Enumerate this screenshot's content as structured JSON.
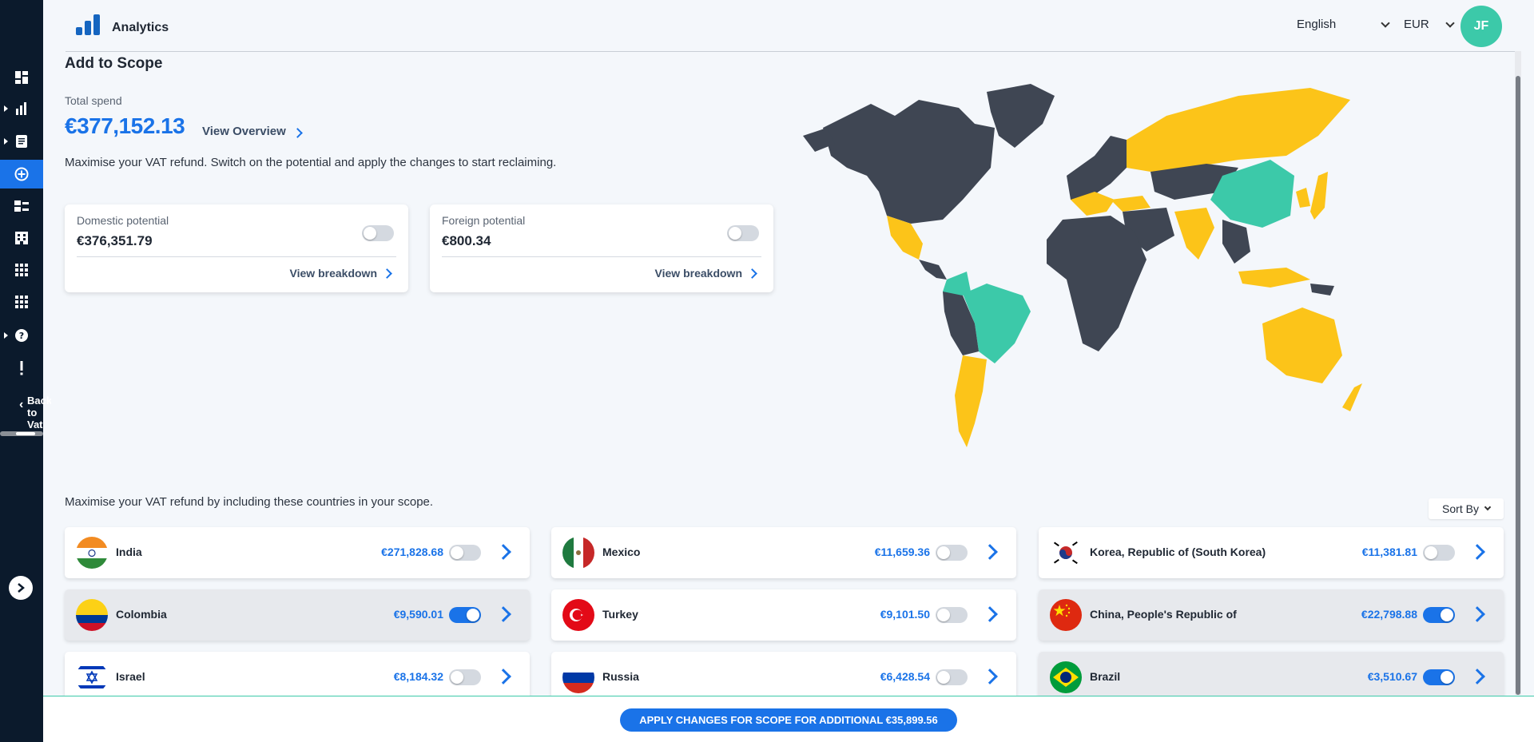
{
  "app": {
    "title": "Analytics"
  },
  "header": {
    "language": "English",
    "currency": "EUR",
    "avatar_initials": "JF"
  },
  "sidebar": {
    "back_label": "Back to Vat",
    "items": [
      {
        "icon": "dashboard-icon"
      },
      {
        "icon": "bar-chart-icon"
      },
      {
        "icon": "document-icon"
      },
      {
        "icon": "add-circle-icon",
        "active": true
      },
      {
        "icon": "list-icon"
      },
      {
        "icon": "building-icon"
      },
      {
        "icon": "grid-icon"
      },
      {
        "icon": "grid-alt-icon"
      },
      {
        "icon": "help-icon"
      },
      {
        "icon": "alert-icon"
      }
    ]
  },
  "page": {
    "title": "Add to Scope",
    "total_label": "Total spend",
    "total_value": "€377,152.13",
    "view_overview": "View Overview",
    "intro": "Maximise your VAT refund. Switch on the potential and apply the changes to start reclaiming.",
    "sub_intro": "Maximise your VAT refund by including these countries in your scope.",
    "sort_by": "Sort By"
  },
  "potentials": {
    "domestic": {
      "label": "Domestic potential",
      "value": "€376,351.79",
      "link": "View breakdown",
      "on": false
    },
    "foreign": {
      "label": "Foreign potential",
      "value": "€800.34",
      "link": "View breakdown",
      "on": false
    }
  },
  "countries": [
    {
      "name": "India",
      "amount": "€271,828.68",
      "on": false
    },
    {
      "name": "Mexico",
      "amount": "€11,659.36",
      "on": false
    },
    {
      "name": "Korea, Republic of (South Korea)",
      "amount": "€11,381.81",
      "on": false
    },
    {
      "name": "Colombia",
      "amount": "€9,590.01",
      "on": true
    },
    {
      "name": "Turkey",
      "amount": "€9,101.50",
      "on": false
    },
    {
      "name": "China, People's Republic of",
      "amount": "€22,798.88",
      "on": true
    },
    {
      "name": "Israel",
      "amount": "€8,184.32",
      "on": false
    },
    {
      "name": "Russia",
      "amount": "€6,428.54",
      "on": false
    },
    {
      "name": "Brazil",
      "amount": "€3,510.67",
      "on": true
    }
  ],
  "footer": {
    "apply_label": "APPLY CHANGES FOR SCOPE FOR ADDITIONAL €35,899.56"
  },
  "colors": {
    "accent": "#1a73e8",
    "in_scope": "#3cc9a9",
    "potential": "#fcc419",
    "other": "#3f4653"
  }
}
